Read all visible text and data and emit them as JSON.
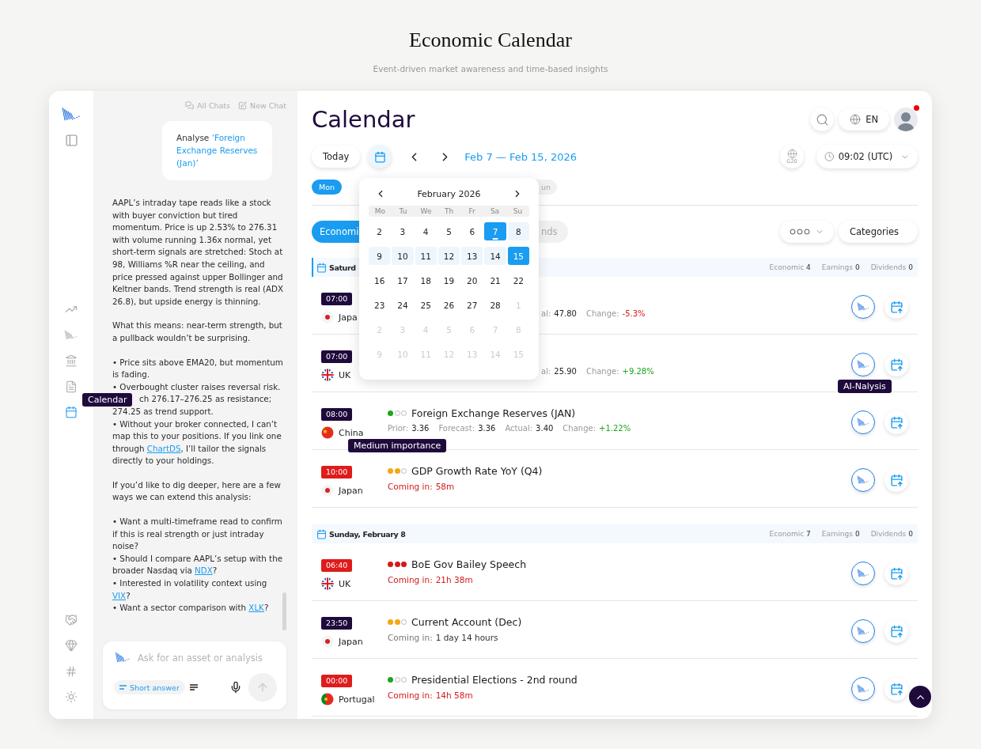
{
  "page": {
    "title": "Economic Calendar",
    "subtitle": "Event-driven market awareness and time-based insights"
  },
  "sidebar": {
    "nav_items": [
      {
        "selected": false
      },
      {
        "selected": false
      },
      {
        "selected": false
      },
      {
        "selected": false
      },
      {
        "selected": true
      }
    ],
    "tooltip": "Calendar"
  },
  "chat": {
    "links": [
      "All Chats",
      "New Chat"
    ],
    "prompt": {
      "prefix": "Analyse",
      "highlight": "‘Foreign Exchange Reserves (Jan)’"
    },
    "blocks": [
      {
        "kind": "para",
        "parts": [
          {
            "text": "AAPL’s intraday tape reads like a stock with buyer conviction but tired momentum. Price is up 2.53% to 276.31 with volume running 1.36x normal, yet short-term signals are stretched: Stoch at 98, Williams %R near the ceiling, and price pressed against upper Bollinger and Keltner bands. Trend strength is real (ADX 26.8), but upside energy is thinning."
          }
        ]
      },
      {
        "kind": "para",
        "parts": [
          {
            "text": "What this means: near-term strength, but a pullback wouldn’t be surprising."
          }
        ]
      },
      {
        "kind": "para",
        "parts": [
          {
            "text": "• Price sits above EMA20, but momentum is fading."
          }
        ]
      },
      {
        "kind": "line",
        "parts": [
          {
            "text": "• Overbought cluster raises reversal risk."
          }
        ]
      },
      {
        "kind": "covered",
        "parts": [
          {
            "text": "ch 276.17–276.25 as resistance;"
          }
        ]
      },
      {
        "kind": "line",
        "parts": [
          {
            "text": "274.25 as trend support."
          }
        ]
      },
      {
        "kind": "line",
        "parts": [
          {
            "text": "• Without your broker connected, I can’t map this to your positions. If you link one through "
          },
          {
            "text": "ChartDS",
            "link": true
          },
          {
            "text": ", I’ll tailor the signals directly to your holdings."
          }
        ]
      },
      {
        "kind": "para",
        "parts": [
          {
            "text": "If you’d like to dig deeper, here are a few ways we can extend this analysis:"
          }
        ]
      },
      {
        "kind": "para",
        "parts": [
          {
            "text": "• Want a multi-timeframe read to confirm if this is real strength or just intraday noise?"
          }
        ]
      },
      {
        "kind": "line",
        "parts": [
          {
            "text": "• Should I compare AAPL’s setup with the broader Nasdaq via "
          },
          {
            "text": "NDX",
            "link": true
          },
          {
            "text": "?"
          }
        ]
      },
      {
        "kind": "line",
        "parts": [
          {
            "text": "• Interested in volatility context using "
          },
          {
            "text": "VIX",
            "link": true
          },
          {
            "text": "?"
          }
        ]
      },
      {
        "kind": "line",
        "parts": [
          {
            "text": "• Want a sector comparison with "
          },
          {
            "text": "XLK",
            "link": true
          },
          {
            "text": "?"
          }
        ]
      }
    ],
    "input": {
      "placeholder": "Ask for an asset or analysis",
      "chip": "Short answer"
    }
  },
  "main": {
    "title": "Calendar",
    "language": "EN",
    "avatar": {
      "has_notification": true
    },
    "toolbar": {
      "today": "Today",
      "range": "Feb 7 — Feb 15, 2026",
      "region": "G20",
      "time": "09:02 (UTC)"
    },
    "day_chips": [
      {
        "label": "Mon",
        "selected": true
      },
      {
        "label": "un",
        "selected": false
      }
    ],
    "category_tabs": [
      {
        "label": "Economi",
        "selected": true
      },
      {
        "label": "nds",
        "selected": false
      }
    ],
    "categories_button": "Categories",
    "sections": [
      {
        "date": "Saturd",
        "selected": true,
        "counts": [
          {
            "label": "Economic",
            "value": "4"
          },
          {
            "label": "Earnings",
            "value": "0"
          },
          {
            "label": "Dividends",
            "value": "0"
          }
        ],
        "events": [
          {
            "time": "07:00",
            "highlight": false,
            "country": {
              "name": "Japa",
              "kind": "japan"
            },
            "metrics": [
              {
                "label": "al:",
                "value": "47.80"
              },
              {
                "label": "Change:",
                "value": "-5.3%",
                "color": "#d11a1a"
              }
            ]
          },
          {
            "time": "07:00",
            "highlight": false,
            "country": {
              "name": "UK",
              "kind": "uk"
            },
            "metrics": [
              {
                "label": "al:",
                "value": "25.90"
              },
              {
                "label": "Change:",
                "value": "+9.28%",
                "color": "#1ca51c"
              }
            ]
          },
          {
            "time": "08:00",
            "highlight": false,
            "country": {
              "name": "China",
              "kind": "china"
            },
            "stars": 1,
            "title": "Foreign Exchange Reserves (JAN)",
            "ai_tooltip": "AI-Nalysis",
            "metrics": [
              {
                "label": "Prior:",
                "value": "3.36"
              },
              {
                "label": "Forecast:",
                "value": "3.36"
              },
              {
                "label": "Actual:",
                "value": "3.40"
              },
              {
                "label": "Change:",
                "value": "+1.22%",
                "color": "#1ca51c"
              }
            ]
          },
          {
            "time": "10:00",
            "highlight": true,
            "country": {
              "name": "Japan",
              "kind": "japan"
            },
            "stars": 2,
            "importance_tooltip": "Medium importance",
            "title": "GDP Growth Rate YoY (Q4)",
            "countdown": {
              "label": "Coming in:",
              "value": "58m",
              "urgent": true
            }
          }
        ]
      },
      {
        "date": "Sunday, February 8",
        "selected": false,
        "counts": [
          {
            "label": "Economic",
            "value": "7"
          },
          {
            "label": "Earnings",
            "value": "0"
          },
          {
            "label": "Dividends",
            "value": "0"
          }
        ],
        "events": [
          {
            "time": "06:40",
            "highlight": true,
            "country": {
              "name": "UK",
              "kind": "uk"
            },
            "stars": 3,
            "title": "BoE Gov Bailey Speech",
            "countdown": {
              "label": "Coming in:",
              "value": "21h 38m",
              "urgent": true
            }
          },
          {
            "time": "23:50",
            "highlight": false,
            "country": {
              "name": "Japan",
              "kind": "japan"
            },
            "stars": 2,
            "title": "Current Account (Dec)",
            "countdown": {
              "label": "Coming in:",
              "value": "1 day 14 hours",
              "urgent": false
            }
          },
          {
            "time": "00:00",
            "highlight": true,
            "country": {
              "name": "Portugal",
              "kind": "portugal"
            },
            "stars": 1,
            "title": "Presidential Elections - 2nd round",
            "countdown": {
              "label": "Coming in:",
              "value": "14h 58m",
              "urgent": true
            }
          }
        ]
      }
    ],
    "calendar": {
      "month": "February 2026",
      "weekdays": [
        "Mo",
        "Tu",
        "We",
        "Th",
        "Fr",
        "Sa",
        "Su"
      ],
      "weeks": [
        [
          {
            "d": "2",
            "muted": false,
            "selected": false,
            "in_range": false,
            "today": false
          },
          {
            "d": "3",
            "muted": false,
            "selected": false,
            "in_range": false,
            "today": false
          },
          {
            "d": "4",
            "muted": false,
            "selected": false,
            "in_range": false,
            "today": false
          },
          {
            "d": "5",
            "muted": false,
            "selected": false,
            "in_range": false,
            "today": false
          },
          {
            "d": "6",
            "muted": false,
            "selected": false,
            "in_range": false,
            "today": false
          },
          {
            "d": "7",
            "muted": false,
            "selected": true,
            "in_range": false,
            "today": true
          },
          {
            "d": "8",
            "muted": false,
            "selected": false,
            "in_range": true,
            "today": false
          }
        ],
        [
          {
            "d": "9",
            "muted": false,
            "selected": false,
            "in_range": true,
            "today": false
          },
          {
            "d": "10",
            "muted": false,
            "selected": false,
            "in_range": true,
            "today": false
          },
          {
            "d": "11",
            "muted": false,
            "selected": false,
            "in_range": true,
            "today": false
          },
          {
            "d": "12",
            "muted": false,
            "selected": false,
            "in_range": true,
            "today": false
          },
          {
            "d": "13",
            "muted": false,
            "selected": false,
            "in_range": true,
            "today": false
          },
          {
            "d": "14",
            "muted": false,
            "selected": false,
            "in_range": true,
            "today": false
          },
          {
            "d": "15",
            "muted": false,
            "selected": true,
            "in_range": false,
            "today": false
          }
        ],
        [
          {
            "d": "16",
            "muted": false,
            "selected": false,
            "in_range": false,
            "today": false
          },
          {
            "d": "17",
            "muted": false,
            "selected": false,
            "in_range": false,
            "today": false
          },
          {
            "d": "18",
            "muted": false,
            "selected": false,
            "in_range": false,
            "today": false
          },
          {
            "d": "19",
            "muted": false,
            "selected": false,
            "in_range": false,
            "today": false
          },
          {
            "d": "20",
            "muted": false,
            "selected": false,
            "in_range": false,
            "today": false
          },
          {
            "d": "21",
            "muted": false,
            "selected": false,
            "in_range": false,
            "today": false
          },
          {
            "d": "22",
            "muted": false,
            "selected": false,
            "in_range": false,
            "today": false
          }
        ],
        [
          {
            "d": "23",
            "muted": false,
            "selected": false,
            "in_range": false,
            "today": false
          },
          {
            "d": "24",
            "muted": false,
            "selected": false,
            "in_range": false,
            "today": false
          },
          {
            "d": "25",
            "muted": false,
            "selected": false,
            "in_range": false,
            "today": false
          },
          {
            "d": "26",
            "muted": false,
            "selected": false,
            "in_range": false,
            "today": false
          },
          {
            "d": "27",
            "muted": false,
            "selected": false,
            "in_range": false,
            "today": false
          },
          {
            "d": "28",
            "muted": false,
            "selected": false,
            "in_range": false,
            "today": false
          },
          {
            "d": "1",
            "muted": true,
            "selected": false,
            "in_range": false,
            "today": false
          }
        ],
        [
          {
            "d": "2",
            "muted": true,
            "selected": false,
            "in_range": false,
            "today": false
          },
          {
            "d": "3",
            "muted": true,
            "selected": false,
            "in_range": false,
            "today": false
          },
          {
            "d": "4",
            "muted": true,
            "selected": false,
            "in_range": false,
            "today": false
          },
          {
            "d": "5",
            "muted": true,
            "selected": false,
            "in_range": false,
            "today": false
          },
          {
            "d": "6",
            "muted": true,
            "selected": false,
            "in_range": false,
            "today": false
          },
          {
            "d": "7",
            "muted": true,
            "selected": false,
            "in_range": false,
            "today": false
          },
          {
            "d": "8",
            "muted": true,
            "selected": false,
            "in_range": false,
            "today": false
          }
        ],
        [
          {
            "d": "9",
            "muted": true,
            "selected": false,
            "in_range": false,
            "today": false
          },
          {
            "d": "10",
            "muted": true,
            "selected": false,
            "in_range": false,
            "today": false
          },
          {
            "d": "11",
            "muted": true,
            "selected": false,
            "in_range": false,
            "today": false
          },
          {
            "d": "12",
            "muted": true,
            "selected": false,
            "in_range": false,
            "today": false
          },
          {
            "d": "13",
            "muted": true,
            "selected": false,
            "in_range": false,
            "today": false
          },
          {
            "d": "14",
            "muted": true,
            "selected": false,
            "in_range": false,
            "today": false
          },
          {
            "d": "15",
            "muted": true,
            "selected": false,
            "in_range": false,
            "today": false
          }
        ]
      ]
    }
  }
}
